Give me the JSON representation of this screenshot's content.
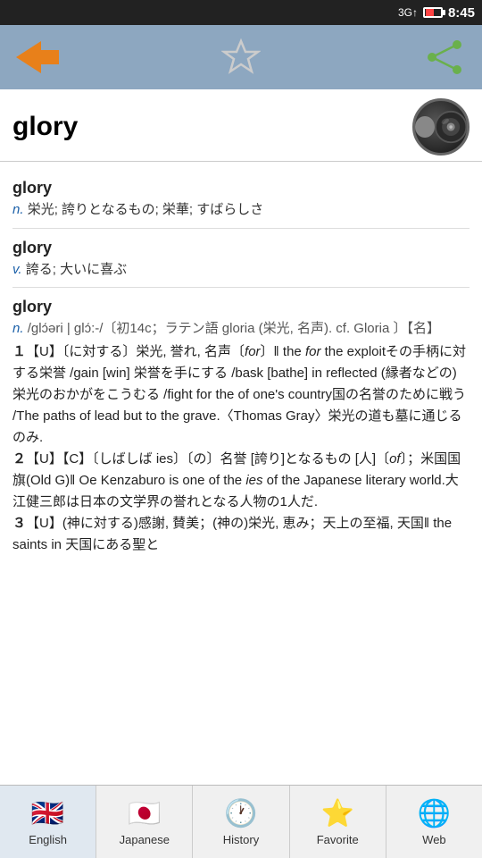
{
  "status": {
    "signal": "3G",
    "time": "8:45"
  },
  "toolbar": {
    "back_label": "Back",
    "star_label": "Favorite",
    "share_label": "Share"
  },
  "word": {
    "title": "glory",
    "speaker_label": "Pronounce"
  },
  "entries": [
    {
      "word": "glory",
      "pos": "n.",
      "definition": "栄光; 誇りとなるもの; 栄華; すばらしさ"
    },
    {
      "word": "glory",
      "pos": "v.",
      "definition": "誇る; 大いに喜ぶ"
    },
    {
      "word": "glory",
      "pos": "n.",
      "phonetics": "/glɔ́əri | glɔ́:-/〔初14c；ラテン語 gloria (栄光, 名声). cf. Gloria 〕【名】",
      "detail": "１【U】〔に対する〕栄光, 誉れ, 名声〔for〕‖ the  for the exploitその手柄に対する栄誉 /gain [win] 栄誉を手にする /bask [bathe] in reflected (縁者などの)栄光のおかがをこうむる /fight for the  of one's country国の名誉のために戦う /The paths of  lead but to the grave.〈Thomas Gray〉栄光の道も墓に通じるのみ.\n２【U】【C】〔しばしば ies〕〔の〕名誉 [誇り]となるもの [人]〔of〕；米国国旗(Old G)‖ Oe Kenzaburo is one of the ies of the Japanese literary world.大江健三郎は日本の文学界の誉れとなる人物の1人だ.\n３【U】(神に対する)感謝, 賛美；(神の)栄光, 恵み；天上の至福, 天国‖ the saints in 天国にある聖と"
    }
  ],
  "nav": {
    "items": [
      {
        "id": "english",
        "label": "English",
        "icon": "🇬🇧",
        "active": true
      },
      {
        "id": "japanese",
        "label": "Japanese",
        "icon": "🇯🇵",
        "active": false
      },
      {
        "id": "history",
        "label": "History",
        "icon": "🕐",
        "active": false
      },
      {
        "id": "favorite",
        "label": "Favorite",
        "icon": "⭐",
        "active": false
      },
      {
        "id": "web",
        "label": "Web",
        "icon": "🌐",
        "active": false
      }
    ]
  }
}
